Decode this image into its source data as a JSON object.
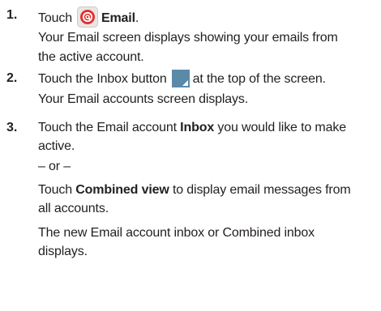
{
  "steps": [
    {
      "number": "1.",
      "lead": "Touch",
      "icon": "email-app-icon",
      "bold": "Email",
      "tail": ".",
      "desc_line1": "Your Email screen displays showing your emails from",
      "desc_line2": "the active account."
    },
    {
      "number": "2.",
      "lead": "Touch the Inbox button",
      "icon": "inbox-dropdown-icon",
      "tail": "at the top of the screen.",
      "desc_line1": "Your Email accounts screen displays."
    },
    {
      "number": "3.",
      "lead": "Touch the Email account",
      "bold": "Inbox",
      "tail": "you would like to make",
      "line2": "active.",
      "or_text": "– or –",
      "alt_lead": "Touch",
      "alt_bold": "Combined view",
      "alt_tail": "to display email messages from",
      "alt_line2": "all accounts.",
      "result_line1": "The new Email account inbox or Combined inbox",
      "result_line2": "displays."
    }
  ],
  "colors": {
    "text": "#231f20",
    "email_icon_red": "#e0322f",
    "inbox_icon_blue": "#5a8aa8"
  }
}
